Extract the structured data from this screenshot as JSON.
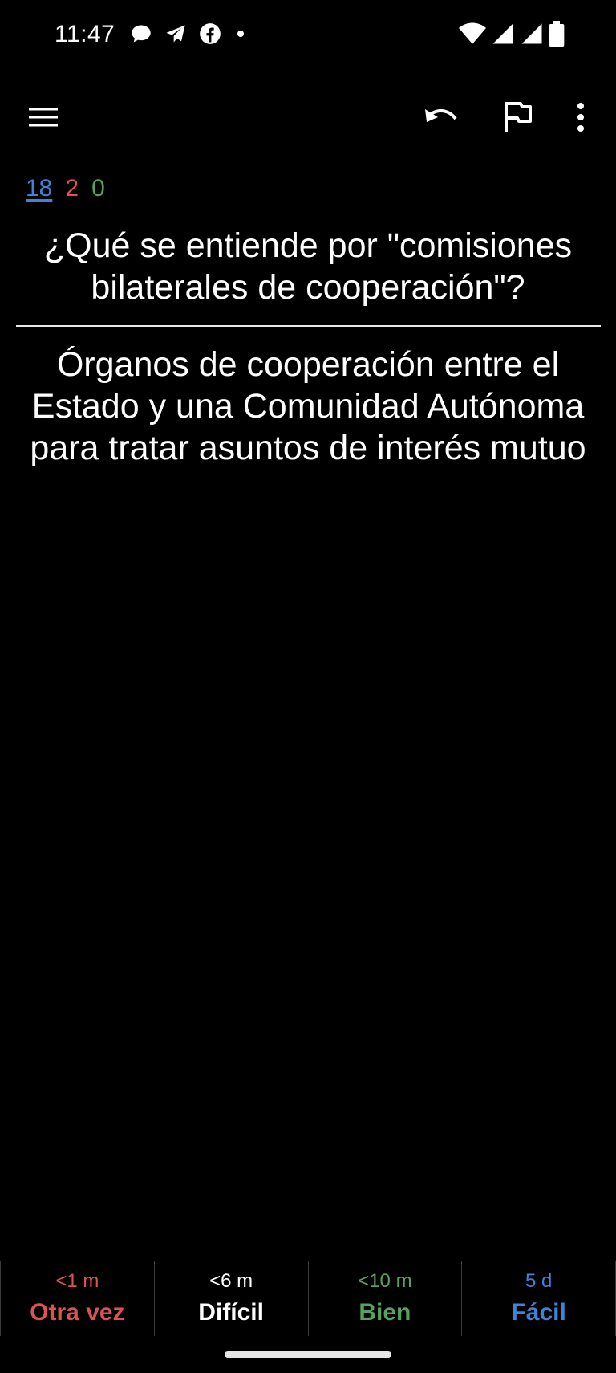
{
  "status_bar": {
    "time": "11:47",
    "left_icons": [
      "chat-bubble-icon",
      "telegram-icon",
      "facebook-icon",
      "dot-icon"
    ],
    "right_icons": [
      "wifi-icon",
      "signal-icon",
      "signal-icon",
      "battery-icon"
    ]
  },
  "toolbar": {
    "icons": [
      "menu-icon",
      "undo-icon",
      "flag-icon",
      "more-vert-icon"
    ]
  },
  "counts": {
    "new": "18",
    "learning": "2",
    "review": "0",
    "colors": {
      "new": "#3f82d8",
      "learning": "#e05252",
      "review": "#56a35f"
    }
  },
  "card": {
    "question": "¿Qué se entiende por \"comisiones bilaterales de cooperación\"?",
    "answer": "Órganos de cooperación entre el Estado y una Comunidad Autónoma para tratar asuntos de interés mutuo"
  },
  "answer_buttons": [
    {
      "time": "<1 m",
      "label": "Otra vez",
      "color": "#e05252"
    },
    {
      "time": "<6 m",
      "label": "Difícil",
      "color": "#ffffff"
    },
    {
      "time": "<10 m",
      "label": "Bien",
      "color": "#56a35f"
    },
    {
      "time": "5 d",
      "label": "Fácil",
      "color": "#3f82d8"
    }
  ]
}
